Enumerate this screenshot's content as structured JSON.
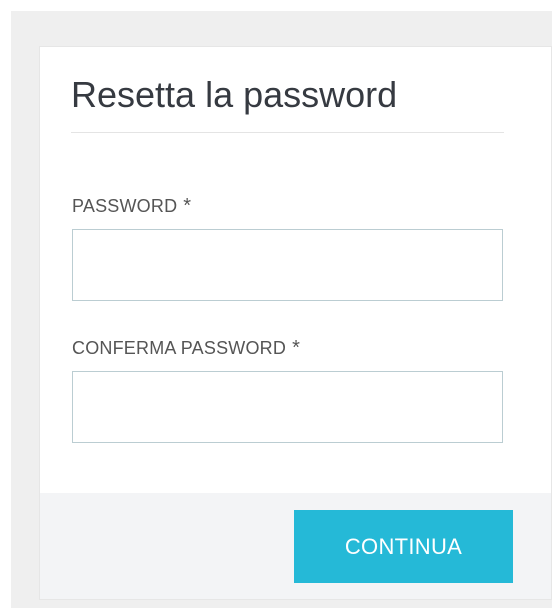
{
  "form": {
    "title": "Resetta la password",
    "fields": [
      {
        "label": "PASSWORD",
        "required_mark": "*",
        "value": ""
      },
      {
        "label": "CONFERMA PASSWORD",
        "required_mark": "*",
        "value": ""
      }
    ],
    "submit_label": "CONTINUA"
  },
  "colors": {
    "background": "#efefef",
    "card": "#ffffff",
    "footer": "#f3f4f6",
    "accent": "#25b9d7",
    "text": "#363a41",
    "input_border": "#bbcdd2"
  }
}
